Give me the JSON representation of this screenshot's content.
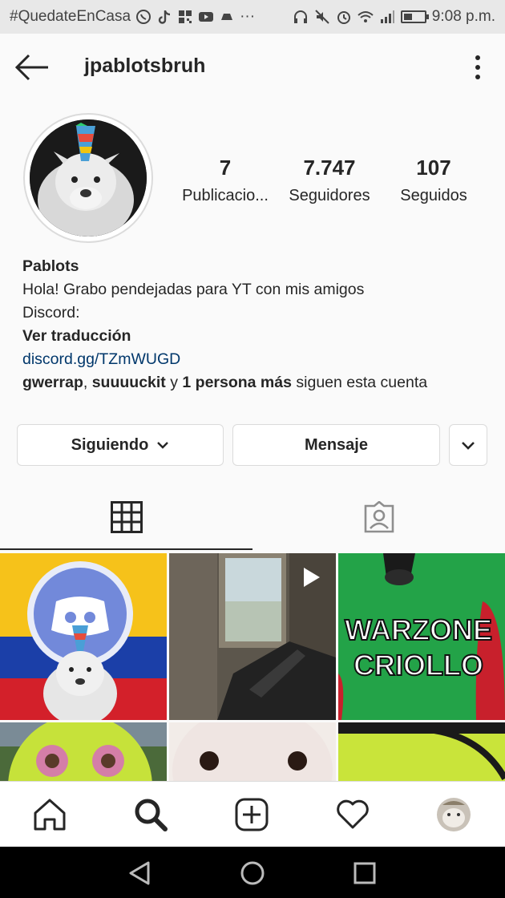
{
  "status_bar": {
    "hashtag": "#QuedateEnCasa",
    "time": "9:08 p.m."
  },
  "header": {
    "username": "jpablotsbruh"
  },
  "profile": {
    "stats": [
      {
        "value": "7",
        "label": "Publicacio..."
      },
      {
        "value": "7.747",
        "label": "Seguidores"
      },
      {
        "value": "107",
        "label": "Seguidos"
      }
    ]
  },
  "bio": {
    "name": "Pablots",
    "line1": "Hola! Grabo pendejadas para YT con mis amigos",
    "line2": "Discord:",
    "translate": "Ver traducción",
    "link": "discord.gg/TZmWUGD",
    "followed_user1": "gwerrap",
    "sep": ", ",
    "followed_user2": "suuuuckit",
    "and": " y ",
    "followed_more": "1 persona más",
    "followed_suffix": " siguen esta cuenta"
  },
  "actions": {
    "following_label": "Siguiendo",
    "message_label": "Mensaje"
  },
  "posts": {
    "warzone_line1": "WARZONE",
    "warzone_line2": "CRIOLLO"
  },
  "colors": {
    "link": "#00376b",
    "border": "#dbdbdb",
    "text": "#262626"
  }
}
